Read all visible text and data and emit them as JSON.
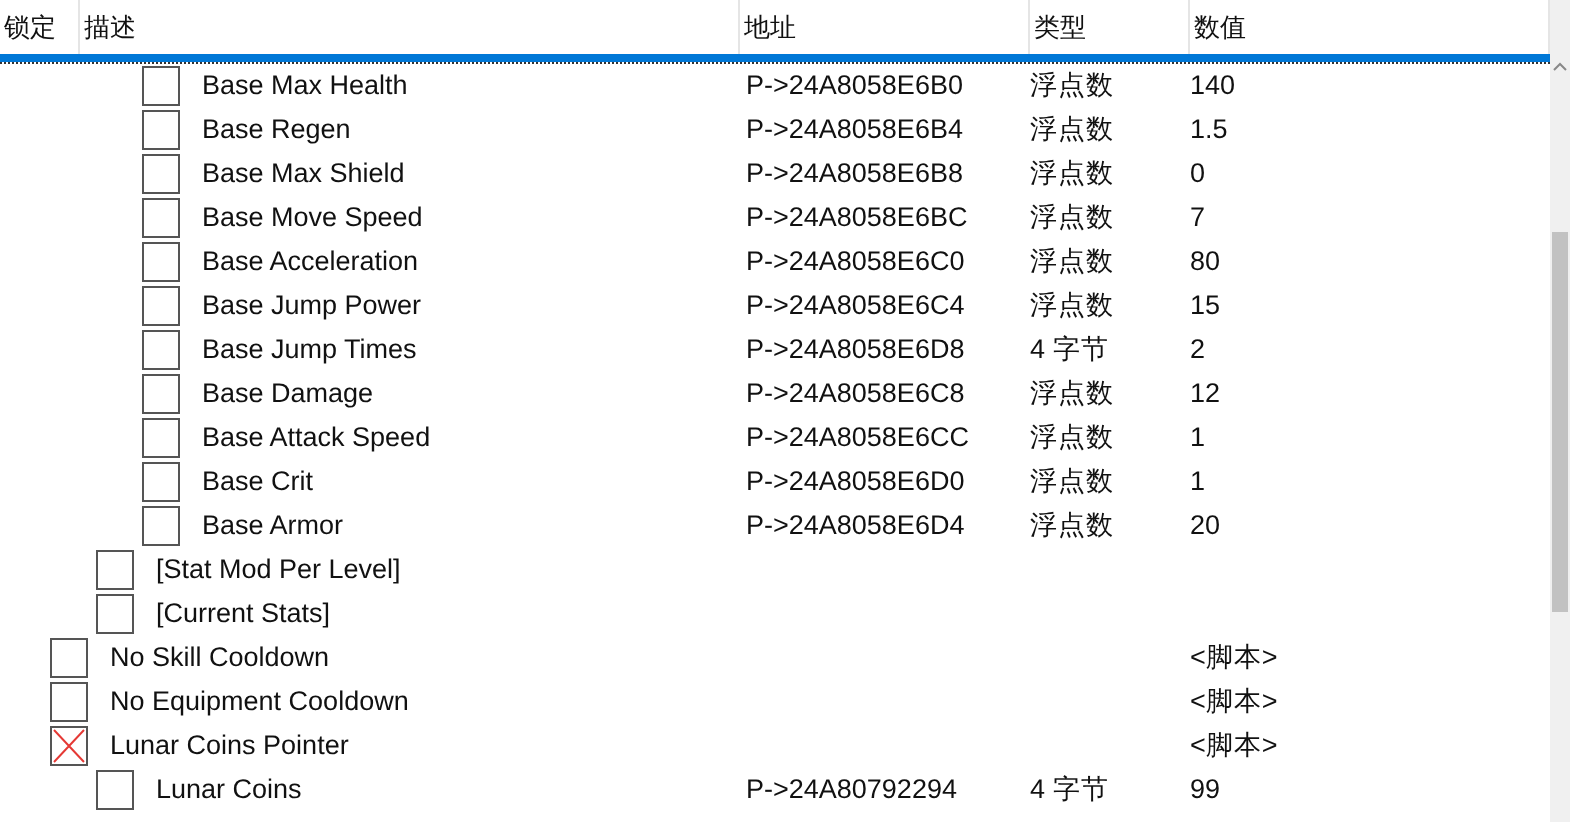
{
  "columns": [
    "锁定",
    "描述",
    "地址",
    "类型",
    "数值"
  ],
  "entries": [
    {
      "kind": "group",
      "children": [
        {
          "kind": "cut",
          "selected": true,
          "children": [
            {
              "kind": "row",
              "description": "Base Max Health",
              "address": "P->24A8058E6B0",
              "type": "浮点数",
              "value": "140",
              "checked": false
            },
            {
              "kind": "row",
              "description": "Base Regen",
              "address": "P->24A8058E6B4",
              "type": "浮点数",
              "value": "1.5",
              "checked": false
            },
            {
              "kind": "row",
              "description": "Base Max Shield",
              "address": "P->24A8058E6B8",
              "type": "浮点数",
              "value": "0",
              "checked": false
            },
            {
              "kind": "row",
              "description": "Base Move Speed",
              "address": "P->24A8058E6BC",
              "type": "浮点数",
              "value": "7",
              "checked": false
            },
            {
              "kind": "row",
              "description": "Base Acceleration",
              "address": "P->24A8058E6C0",
              "type": "浮点数",
              "value": "80",
              "checked": false
            },
            {
              "kind": "row",
              "description": "Base Jump Power",
              "address": "P->24A8058E6C4",
              "type": "浮点数",
              "value": "15",
              "checked": false
            },
            {
              "kind": "row",
              "description": "Base Jump Times",
              "address": "P->24A8058E6D8",
              "type": "4 字节",
              "value": "2",
              "checked": false
            },
            {
              "kind": "row",
              "description": "Base Damage",
              "address": "P->24A8058E6C8",
              "type": "浮点数",
              "value": "12",
              "checked": false
            },
            {
              "kind": "row",
              "description": "Base Attack Speed",
              "address": "P->24A8058E6CC",
              "type": "浮点数",
              "value": "1",
              "checked": false
            },
            {
              "kind": "row",
              "description": "Base Crit",
              "address": "P->24A8058E6D0",
              "type": "浮点数",
              "value": "1",
              "checked": false
            },
            {
              "kind": "row",
              "description": "Base Armor",
              "address": "P->24A8058E6D4",
              "type": "浮点数",
              "value": "20",
              "checked": false
            }
          ]
        },
        {
          "kind": "row",
          "description": "[Stat Mod Per Level]",
          "checked": false
        },
        {
          "kind": "row",
          "description": "[Current Stats]",
          "checked": false
        }
      ]
    },
    {
      "kind": "row",
      "description": "No Skill Cooldown",
      "value": "<脚本>",
      "checked": false
    },
    {
      "kind": "row",
      "description": "No Equipment Cooldown",
      "value": "<脚本>",
      "checked": false
    },
    {
      "kind": "row",
      "description": "Lunar Coins Pointer",
      "value": "<脚本>",
      "checked": true,
      "children": [
        {
          "kind": "row",
          "description": "Lunar Coins",
          "address": "P->24A80792294",
          "type": "4 字节",
          "value": "99",
          "checked": false
        }
      ]
    }
  ]
}
